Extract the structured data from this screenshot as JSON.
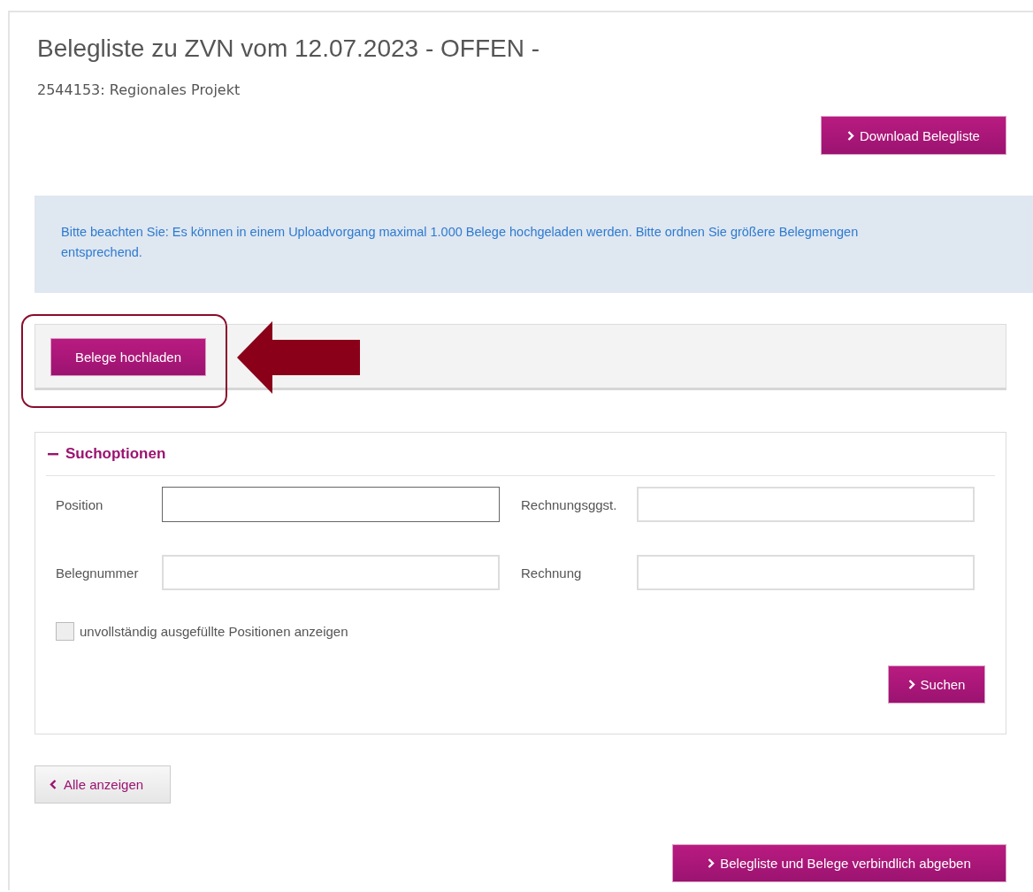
{
  "title": "Belegliste zu ZVN vom 12.07.2023 - OFFEN -",
  "subtitle": "2544153: Regionales Projekt",
  "download_button": "Download Belegliste",
  "notice": "Bitte beachten Sie: Es können in einem Uploadvorgang maximal 1.000 Belege hochgeladen werden. Bitte ordnen Sie größere Belegmengen entsprechend.",
  "upload_button": "Belege hochladen",
  "search": {
    "title": "Suchoptionen",
    "expanded": true,
    "fields": [
      {
        "label": "Position",
        "focused": true
      },
      {
        "label": "Rechnungsggst.",
        "focused": false
      },
      {
        "label": "Belegnummer",
        "focused": false
      },
      {
        "label": "Rechnung",
        "focused": false
      }
    ],
    "checkbox": {
      "label": "unvollständig ausgefüllte Positionen anzeigen",
      "checked": false
    },
    "search_button": "Suchen"
  },
  "show_all_button": "Alle anzeigen",
  "submit_button": "Belegliste und Belege verbindlich abgeben"
}
